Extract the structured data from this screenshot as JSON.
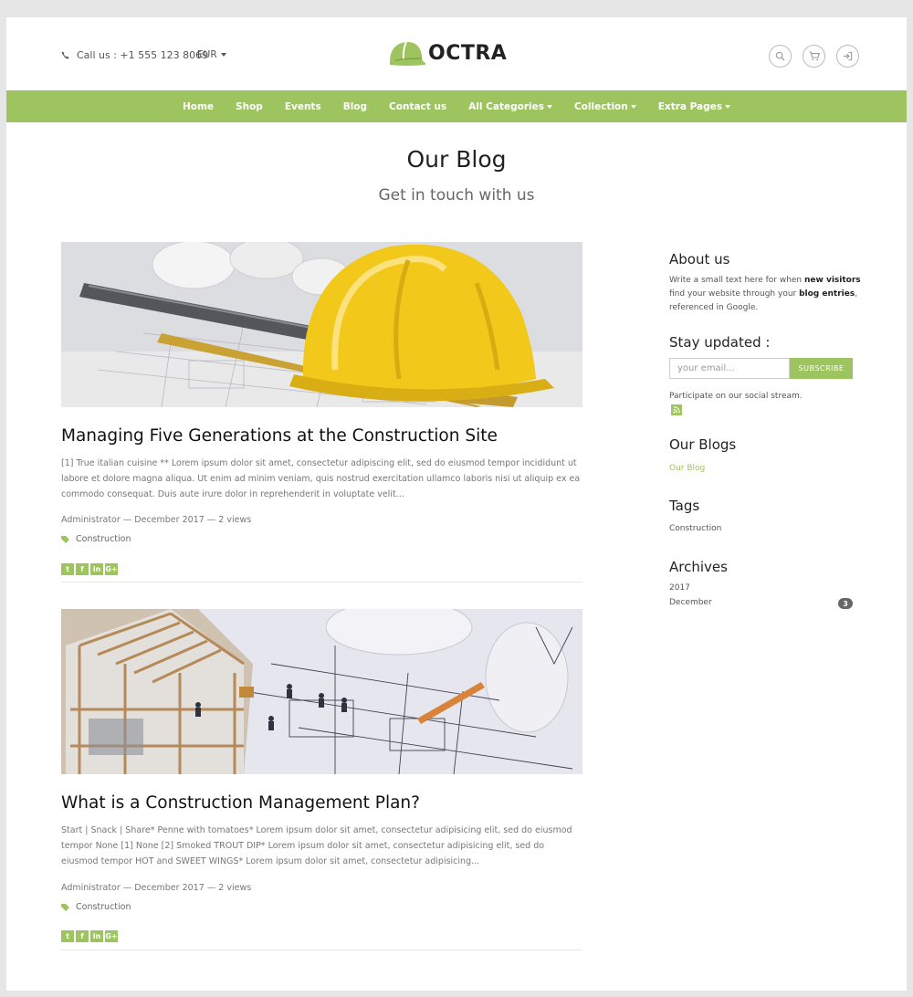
{
  "header": {
    "phone_label": "Call us : +1 555 123 8069",
    "currency": "EUR",
    "logo_text": "OCTRA",
    "icons": [
      "search-icon",
      "cart-icon",
      "login-icon"
    ]
  },
  "nav": {
    "items": [
      {
        "label": "Home",
        "dropdown": false
      },
      {
        "label": "Shop",
        "dropdown": false
      },
      {
        "label": "Events",
        "dropdown": false
      },
      {
        "label": "Blog",
        "dropdown": false
      },
      {
        "label": "Contact us",
        "dropdown": false
      },
      {
        "label": "All Categories",
        "dropdown": true
      },
      {
        "label": "Collection",
        "dropdown": true
      },
      {
        "label": "Extra Pages",
        "dropdown": true
      }
    ]
  },
  "page": {
    "title": "Our Blog",
    "subtitle": "Get in touch with us"
  },
  "posts": [
    {
      "title": "Managing Five Generations at the Construction Site",
      "excerpt": "[1] True italian cuisine ** Lorem ipsum dolor sit amet, consectetur adipiscing elit, sed do eiusmod tempor incididunt ut labore et dolore magna aliqua. Ut enim ad minim veniam, quis nostrud exercitation ullamco laboris nisi ut aliquip ex ea commodo consequat. Duis aute irure dolor in reprehenderit in voluptate velit...",
      "meta": "Administrator — December 2017 — 2 views",
      "tag": "Construction"
    },
    {
      "title": "What is a Construction Management Plan?",
      "excerpt": "Start | Snack | Share* Penne with tomatoes* Lorem ipsum dolor sit amet, consectetur adipisicing elit, sed do eiusmod tempor None [1] None [2] Smoked TROUT DIP* Lorem ipsum dolor sit amet, consectetur adipisicing elit, sed do eiusmod tempor HOT and SWEET WINGS* Lorem ipsum dolor sit amet, consectetur adipisicing...",
      "meta": "Administrator — December 2017 — 2 views",
      "tag": "Construction"
    }
  ],
  "social_icons": [
    "twitter-icon",
    "facebook-icon",
    "linkedin-icon",
    "google-plus-icon"
  ],
  "sidebar": {
    "about": {
      "heading": "About us",
      "text_1": "Write a small text here for when ",
      "bold_1": "new visitors",
      "text_2": " find your website through your ",
      "bold_2": "blog entries",
      "text_3": ", referenced in Google."
    },
    "stay": {
      "heading": "Stay updated :",
      "placeholder": "your email...",
      "button": "SUBSCRIBE",
      "social_text": "Participate on our social stream."
    },
    "blogs": {
      "heading": "Our Blogs",
      "link": "Our Blog"
    },
    "tags": {
      "heading": "Tags",
      "item": "Construction"
    },
    "archives": {
      "heading": "Archives",
      "year": "2017",
      "month": "December",
      "count": "3"
    }
  },
  "colors": {
    "accent": "#9dc45f",
    "helmet": "#f2c81a",
    "badge": "#666666"
  }
}
